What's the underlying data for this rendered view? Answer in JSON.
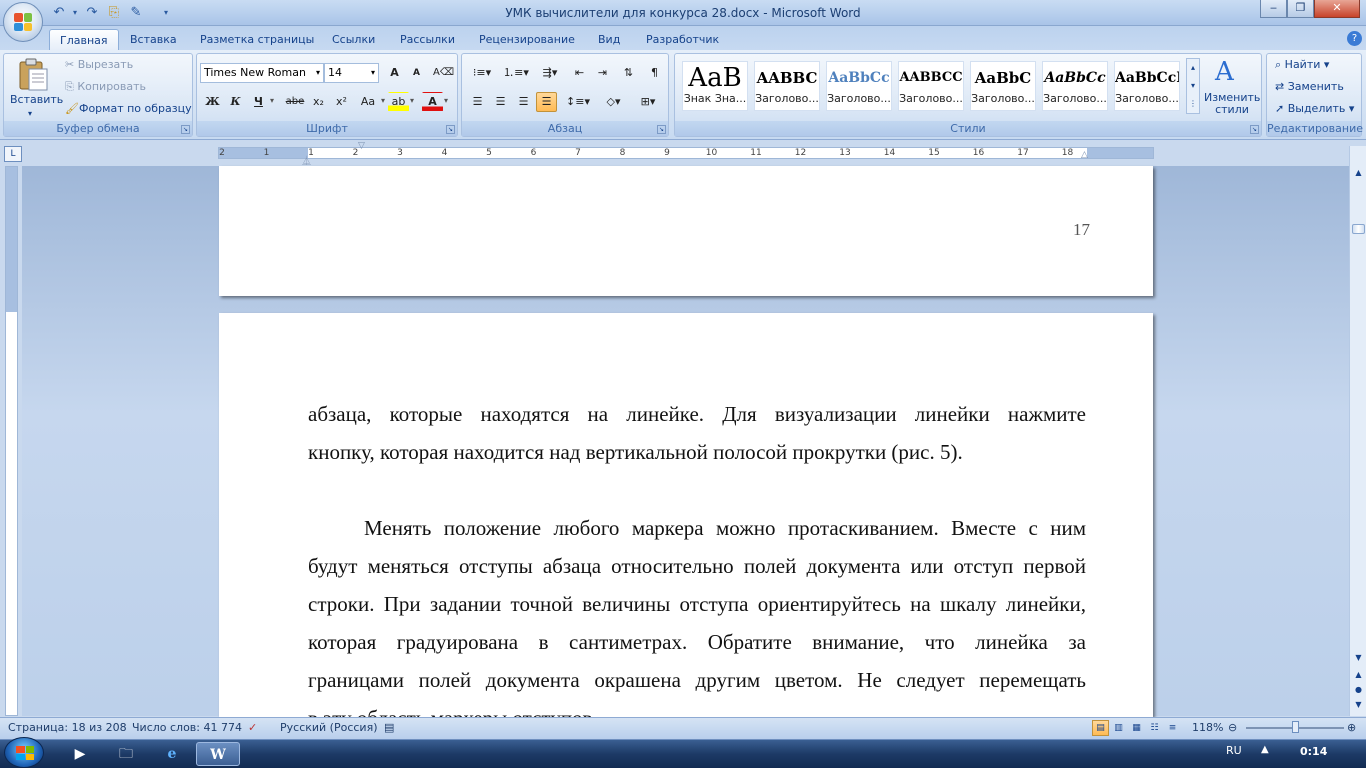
{
  "window": {
    "title": "УМК вычислители для конкурса 28.docx - Microsoft Word",
    "minimize": "‒",
    "maximize": "❐",
    "close": "✕"
  },
  "quick_access": [
    "↶",
    "↷",
    "⎘",
    "✎"
  ],
  "tabs": [
    {
      "label": "Главная",
      "active": true
    },
    {
      "label": "Вставка"
    },
    {
      "label": "Разметка страницы"
    },
    {
      "label": "Ссылки"
    },
    {
      "label": "Рассылки"
    },
    {
      "label": "Рецензирование"
    },
    {
      "label": "Вид"
    },
    {
      "label": "Разработчик"
    }
  ],
  "clipboard": {
    "label": "Буфер обмена",
    "paste": "Вставить",
    "cut": "Вырезать",
    "copy": "Копировать",
    "format_painter": "Формат по образцу"
  },
  "font": {
    "label": "Шрифт",
    "name": "Times New Roman",
    "size": "14",
    "grow": "A",
    "shrink": "A",
    "bold": "Ж",
    "italic": "К",
    "underline": "Ч",
    "strike": "abe",
    "sub": "x₂",
    "sup": "x²",
    "case": "Aa",
    "highlight": "ab",
    "color": "A"
  },
  "paragraph": {
    "label": "Абзац"
  },
  "styles": {
    "label": "Стили",
    "items": [
      {
        "sample": "AaB",
        "name": "Знак Зна...",
        "font_size": "26px",
        "weight": "normal",
        "color": "#000000",
        "italic": false
      },
      {
        "sample": "AABBC",
        "name": "Заголово...",
        "font_size": "15px",
        "weight": "bold",
        "color": "#000000",
        "italic": false
      },
      {
        "sample": "AaBbCc",
        "name": "Заголово...",
        "font_size": "14px",
        "weight": "bold",
        "color": "#4f81bd",
        "italic": false
      },
      {
        "sample": "AABBCC",
        "name": "Заголово...",
        "font_size": "13px",
        "weight": "bold",
        "color": "#000000",
        "italic": false
      },
      {
        "sample": "AaBbC",
        "name": "Заголово...",
        "font_size": "15px",
        "weight": "bold",
        "color": "#000000",
        "italic": false
      },
      {
        "sample": "AaBbCc",
        "name": "Заголово...",
        "font_size": "14px",
        "weight": "bold",
        "color": "#000000",
        "italic": true
      },
      {
        "sample": "AaBbCcI",
        "name": "Заголово...",
        "font_size": "14px",
        "weight": "bold",
        "color": "#000000",
        "italic": false
      }
    ],
    "change_styles": "Изменить стили"
  },
  "editing": {
    "label": "Редактирование",
    "find": "Найти",
    "replace": "Заменить",
    "select": "Выделить"
  },
  "ruler": {
    "numbers": [
      "2",
      "1",
      "1",
      "2",
      "3",
      "4",
      "5",
      "6",
      "7",
      "8",
      "9",
      "10",
      "11",
      "12",
      "13",
      "14",
      "15",
      "16",
      "17",
      "18"
    ]
  },
  "document": {
    "page_number": "17",
    "lines": [
      {
        "text": "абзаца, которые находятся на линейке. Для визуализации линейки нажмите",
        "justify": true
      },
      {
        "text": "кнопку, которая находится над вертикальной полосой прокрутки (рис. 5).",
        "justify": false
      },
      {
        "text": "Менять положение любого маркера можно протаскиванием. Вместе с ним",
        "justify": true,
        "indent": true
      },
      {
        "text": "будут меняться отступы абзаца относительно полей документа или отступ первой",
        "justify": true
      },
      {
        "text": "строки. При задании точной величины отступа ориентируйтесь на шкалу линейки,",
        "justify": true
      },
      {
        "text": "которая градуирована в сантиметрах. Обратите внимание, что линейка за",
        "justify": true
      },
      {
        "text": "границами полей документа окрашена другим цветом. Не следует перемещать",
        "justify": true
      },
      {
        "text": "в эту область маркеры отступов.",
        "justify": false
      }
    ]
  },
  "status": {
    "page": "Страница: 18 из 208",
    "words": "Число слов: 41 774",
    "language": "Русский (Россия)",
    "zoom": "118%"
  },
  "taskbar": {
    "lang": "RU",
    "time": "0:14"
  }
}
